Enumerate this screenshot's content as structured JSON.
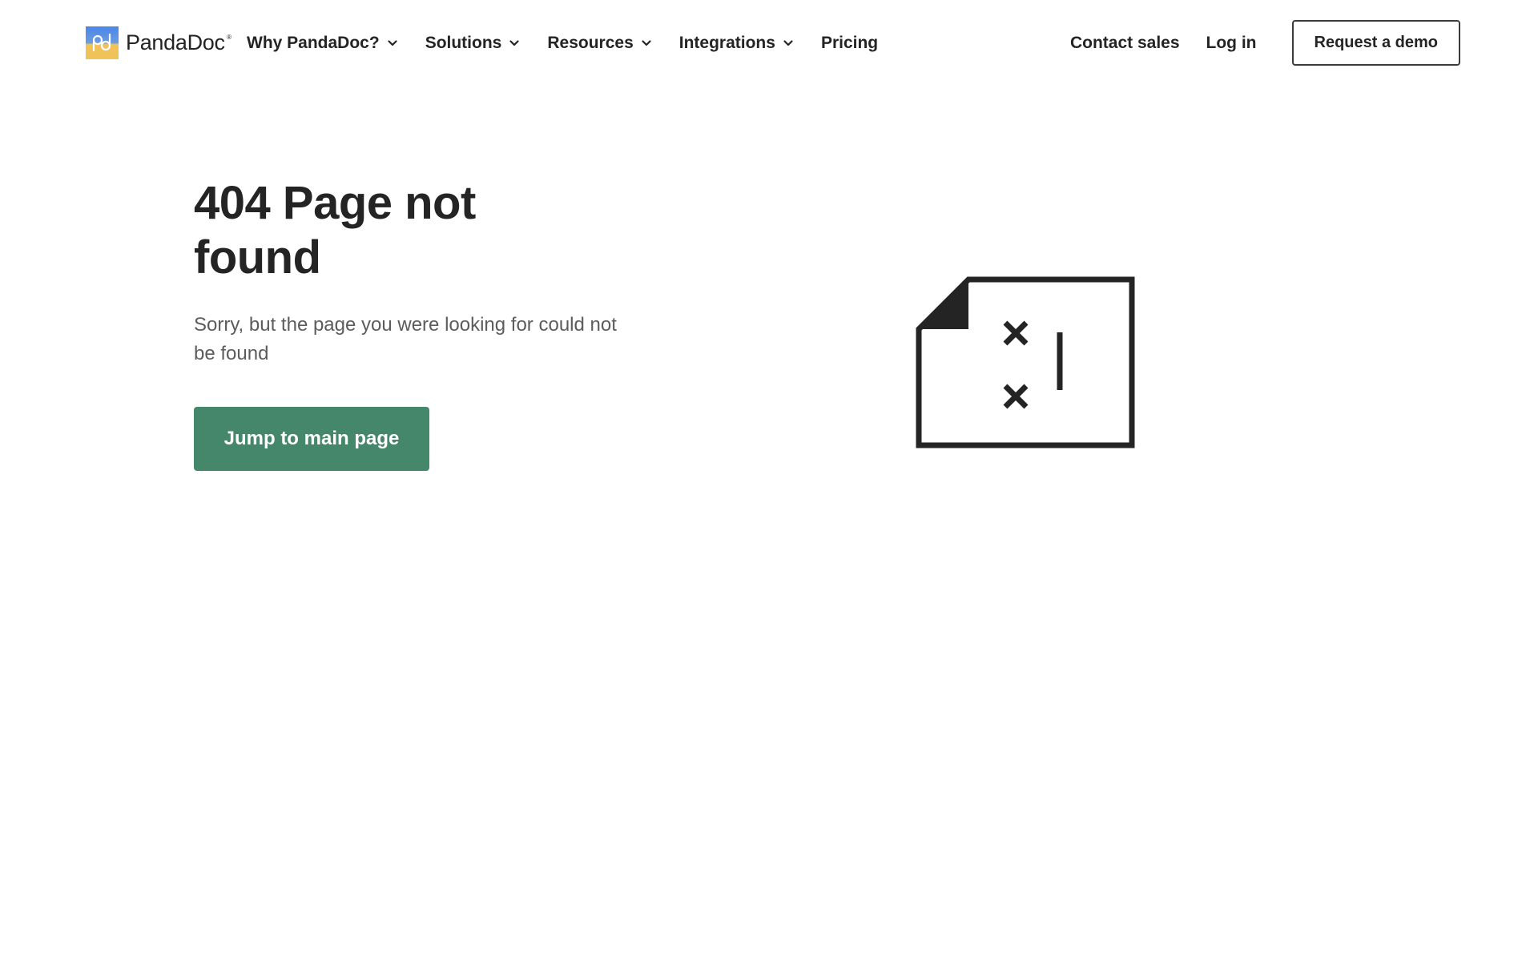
{
  "brand": {
    "name": "PandaDoc",
    "reg": "®",
    "logo_mark_text": "pd",
    "colors": {
      "logo_top": "#4a86e8",
      "logo_bottom": "#f0c35a",
      "primary_button": "#45876a",
      "text": "#242424",
      "muted_text": "#5c5c5c"
    }
  },
  "nav": {
    "items": [
      {
        "label": "Why PandaDoc?",
        "has_dropdown": true,
        "icon": "chevron-down-icon"
      },
      {
        "label": "Solutions",
        "has_dropdown": true,
        "icon": "chevron-down-icon"
      },
      {
        "label": "Resources",
        "has_dropdown": true,
        "icon": "chevron-down-icon"
      },
      {
        "label": "Integrations",
        "has_dropdown": true,
        "icon": "chevron-down-icon"
      },
      {
        "label": "Pricing",
        "has_dropdown": false
      }
    ],
    "contact_sales": "Contact sales",
    "log_in": "Log in",
    "request_demo": "Request a demo"
  },
  "error_page": {
    "title": "404 Page not found",
    "message": "Sorry, but the page you were looking for could not be found",
    "button_label": "Jump to main page",
    "illustration_icon": "broken-document-icon"
  }
}
